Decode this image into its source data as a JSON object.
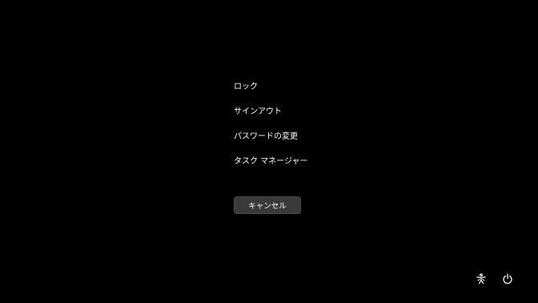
{
  "menu": {
    "items": [
      {
        "label": "ロック"
      },
      {
        "label": "サインアウト"
      },
      {
        "label": "パスワードの変更"
      },
      {
        "label": "タスク マネージャー"
      }
    ]
  },
  "cancel_label": "キャンセル",
  "corner_icons": {
    "accessibility": "accessibility-icon",
    "power": "power-icon"
  },
  "colors": {
    "background": "#000000",
    "text": "#ffffff",
    "button_bg": "#3a3a3a"
  }
}
